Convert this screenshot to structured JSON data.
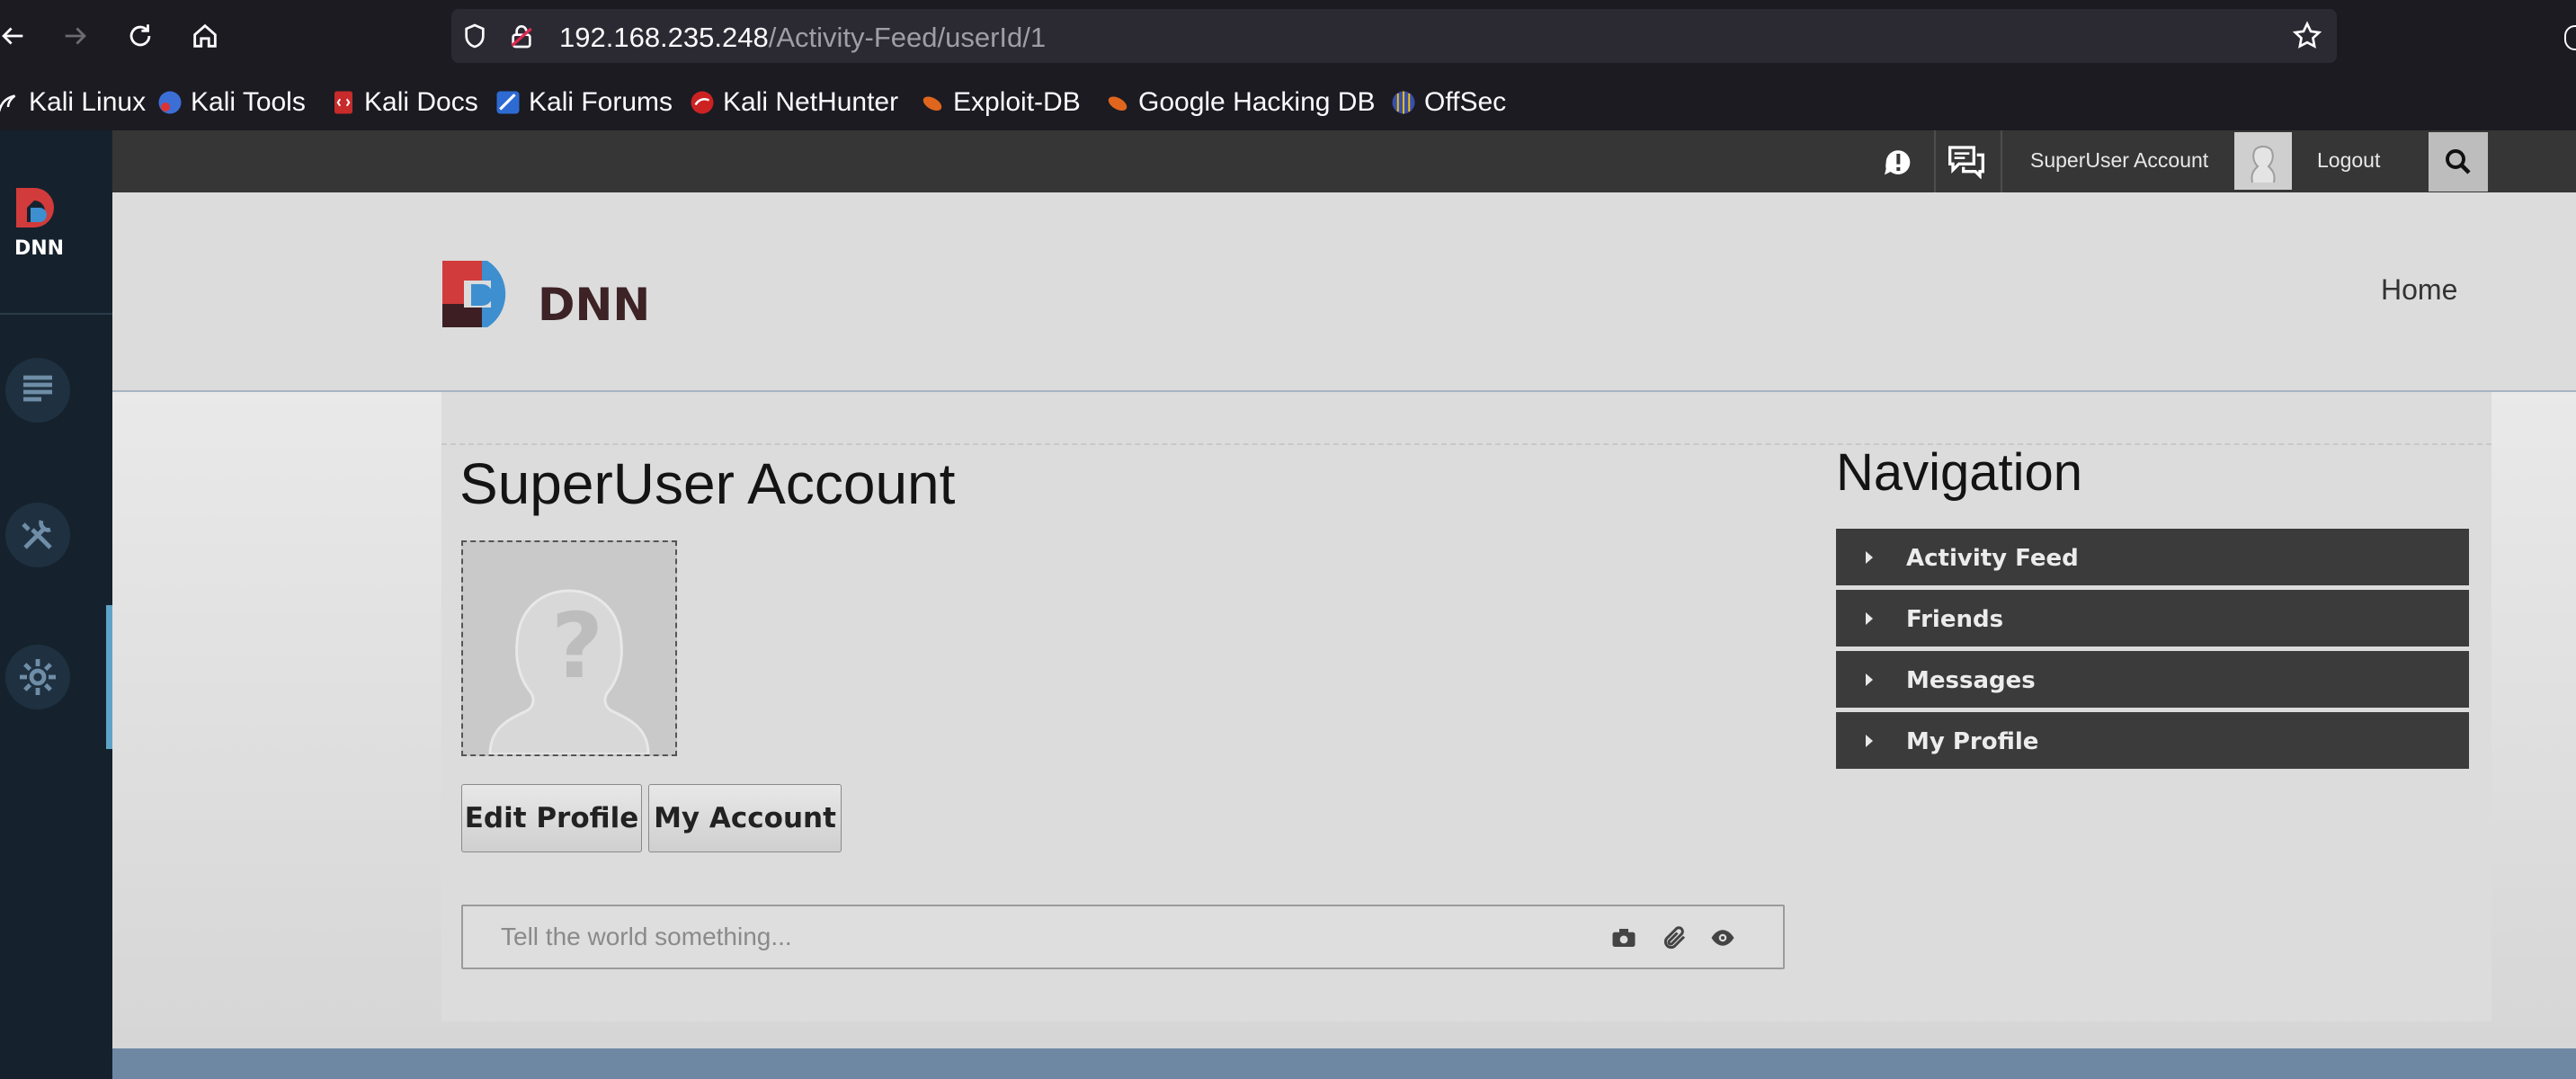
{
  "browser": {
    "url_host": "192.168.235.248",
    "url_path": "/Activity-Feed/userId/1",
    "bookmarks": [
      {
        "label": "Kali Linux"
      },
      {
        "label": "Kali Tools"
      },
      {
        "label": "Kali Docs"
      },
      {
        "label": "Kali Forums"
      },
      {
        "label": "Kali NetHunter"
      },
      {
        "label": "Exploit-DB"
      },
      {
        "label": "Google Hacking DB"
      },
      {
        "label": "OffSec"
      }
    ]
  },
  "topbar": {
    "user_name": "SuperUser Account",
    "logout": "Logout"
  },
  "header": {
    "home_link": "Home"
  },
  "profile": {
    "title": "SuperUser Account",
    "edit_profile": "Edit Profile",
    "my_account": "My Account",
    "post_placeholder": "Tell the world something..."
  },
  "navigation": {
    "heading": "Navigation",
    "items": [
      {
        "label": "Activity Feed"
      },
      {
        "label": "Friends"
      },
      {
        "label": "Messages"
      },
      {
        "label": "My Profile"
      }
    ]
  },
  "colors": {
    "sidebar": "#15222d",
    "topbar": "#363636",
    "dnn_red": "#d13b3b",
    "dnn_blue": "#3d8fd0",
    "footer": "#6e88a3"
  }
}
